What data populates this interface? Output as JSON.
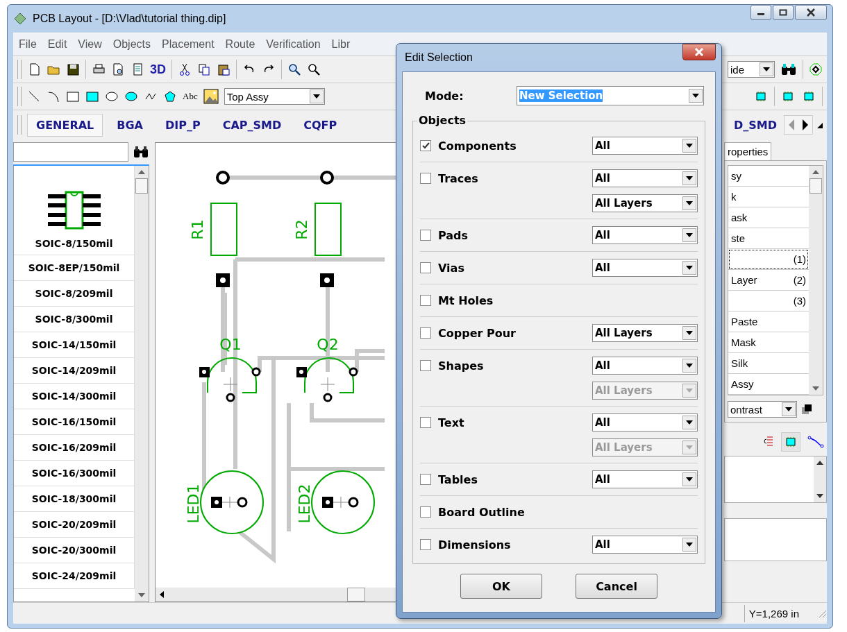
{
  "window": {
    "title": "PCB Layout - [D:\\Vlad\\tutorial thing.dip]"
  },
  "menu": [
    "File",
    "Edit",
    "View",
    "Objects",
    "Placement",
    "Route",
    "Verification",
    "Libr"
  ],
  "toolbar": {
    "text_3d": "3D",
    "text_tool": "Abc",
    "layer_combo": "Top Assy",
    "side_combo": "ide"
  },
  "component_tabs": [
    {
      "label": "GENERAL",
      "selected": true
    },
    {
      "label": "BGA",
      "selected": false
    },
    {
      "label": "DIP_P",
      "selected": false
    },
    {
      "label": "CAP_SMD",
      "selected": false
    },
    {
      "label": "CQFP",
      "selected": false
    },
    {
      "label": "D_SMD",
      "selected": false
    }
  ],
  "library": {
    "items": [
      "SOIC-8/150mil",
      "SOIC-8EP/150mil",
      "SOIC-8/209mil",
      "SOIC-8/300mil",
      "SOIC-14/150mil",
      "SOIC-14/209mil",
      "SOIC-14/300mil",
      "SOIC-16/150mil",
      "SOIC-16/209mil",
      "SOIC-16/300mil",
      "SOIC-18/300mil",
      "SOIC-20/209mil",
      "SOIC-20/300mil",
      "SOIC-24/209mil"
    ]
  },
  "canvas": {
    "components": [
      {
        "kind": "resistor",
        "label": "R1"
      },
      {
        "kind": "resistor",
        "label": "R2"
      },
      {
        "kind": "transistor",
        "label": "Q1"
      },
      {
        "kind": "transistor",
        "label": "Q2"
      },
      {
        "kind": "led",
        "label": "LED1"
      },
      {
        "kind": "led",
        "label": "LED2"
      }
    ]
  },
  "right_panel": {
    "tab": "roperties",
    "layers": [
      {
        "name": "sy",
        "selected": false
      },
      {
        "name": "k",
        "selected": false
      },
      {
        "name": "ask",
        "selected": false
      },
      {
        "name": "ste",
        "selected": false
      },
      {
        "number": "(1)",
        "selected": true
      },
      {
        "name": "Layer",
        "number": "(2)",
        "selected": false
      },
      {
        "number": "(3)",
        "selected": false
      },
      {
        "name": "Paste",
        "selected": false
      },
      {
        "name": "Mask",
        "selected": false
      },
      {
        "name": "Silk",
        "selected": false
      },
      {
        "name": "Assy",
        "selected": false
      }
    ],
    "contrast_combo": "ontrast"
  },
  "status_bar": {
    "y_coordinate": "Y=1,269 in"
  },
  "dialog": {
    "title": "Edit Selection",
    "mode_label": "Mode:",
    "mode_value": "New Selection",
    "group_title": "Objects",
    "rows": [
      {
        "label": "Components",
        "checked": true,
        "combos": [
          {
            "value": "All",
            "disabled": false
          }
        ]
      },
      {
        "label": "Traces",
        "checked": false,
        "combos": [
          {
            "value": "All",
            "disabled": false
          },
          {
            "value": "All Layers",
            "disabled": false
          }
        ]
      },
      {
        "label": "Pads",
        "checked": false,
        "combos": [
          {
            "value": "All",
            "disabled": false
          }
        ]
      },
      {
        "label": "Vias",
        "checked": false,
        "combos": [
          {
            "value": "All",
            "disabled": false
          }
        ]
      },
      {
        "label": "Mt Holes",
        "checked": false
      },
      {
        "label": "Copper Pour",
        "checked": false,
        "combos": [
          {
            "value": "All Layers",
            "disabled": false
          }
        ]
      },
      {
        "label": "Shapes",
        "checked": false,
        "combos": [
          {
            "value": "All",
            "disabled": false
          },
          {
            "value": "All Layers",
            "disabled": true
          }
        ]
      },
      {
        "label": "Text",
        "checked": false,
        "combos": [
          {
            "value": "All",
            "disabled": false
          },
          {
            "value": "All Layers",
            "disabled": true
          }
        ]
      },
      {
        "label": "Tables",
        "checked": false,
        "combos": [
          {
            "value": "All",
            "disabled": false
          }
        ]
      },
      {
        "label": "Board Outline",
        "checked": false
      },
      {
        "label": "Dimensions",
        "checked": false,
        "combos": [
          {
            "value": "All",
            "disabled": false
          }
        ]
      }
    ],
    "buttons": [
      "OK",
      "Cancel"
    ]
  }
}
